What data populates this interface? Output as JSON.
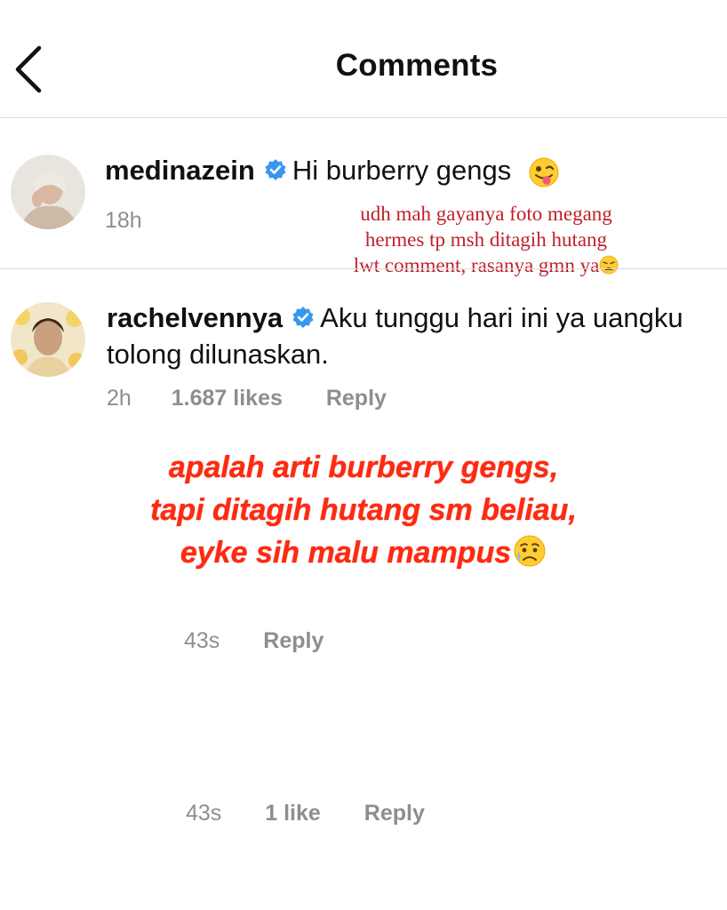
{
  "header": {
    "title": "Comments",
    "back_icon": "chevron-left-icon"
  },
  "comments": [
    {
      "username": "medinazein",
      "verified": true,
      "text": "Hi burberry gengs",
      "emoji": "winking-face-with-tongue",
      "time": "18h"
    },
    {
      "username": "rachelvennya",
      "verified": true,
      "text_line1": "Aku tunggu hari ini ya uangku",
      "text_line2": "tolong dilunaskan.",
      "time": "2h",
      "likes": "1.687 likes",
      "reply": "Reply"
    }
  ],
  "replies": [
    {
      "time": "43s",
      "reply": "Reply"
    },
    {
      "time": "43s",
      "likes": "1 like",
      "reply": "Reply"
    }
  ],
  "annotations": {
    "small_line1": "udh mah gayanya foto megang",
    "small_line2": "hermes tp msh ditagih hutang",
    "small_line3": "lwt comment, rasanya gmn ya",
    "big_line1": "apalah arti burberry gengs,",
    "big_line2": "tapi ditagih hutang sm beliau,",
    "big_line3": "eyke sih malu mampus",
    "colors": {
      "small": "#c0202a",
      "big": "#ff2a10"
    }
  },
  "colors": {
    "verified": "#3897f0",
    "meta": "#8e8e8e",
    "divider": "#dbdbdb"
  }
}
